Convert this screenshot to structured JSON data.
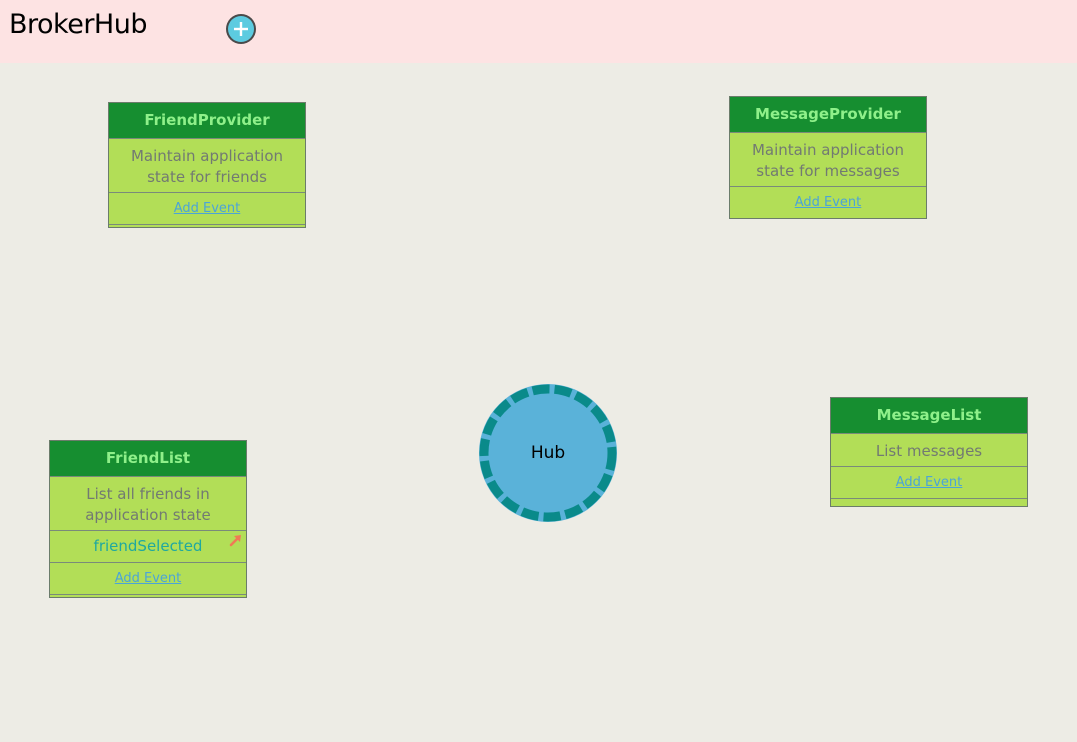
{
  "app": {
    "title": "BrokerHub",
    "add_icon": "plus-circle-icon"
  },
  "colors": {
    "header_bg": "#fde3e3",
    "workspace_bg": "#edece5",
    "card_header": "#168e30",
    "card_header_text": "#8ff08a",
    "card_body": "#b2de57",
    "hub_fill": "#5ab2d9",
    "hub_ring": "#0a8a8a",
    "link": "#4ba4d8",
    "event_text": "#1fa8a0",
    "event_arrow": "#f07a55"
  },
  "cards": {
    "friend_provider": {
      "title": "FriendProvider",
      "description": "Maintain application state for friends",
      "add_event": "Add Event"
    },
    "message_provider": {
      "title": "MessageProvider",
      "description": "Maintain application state for messages",
      "add_event": "Add Event"
    },
    "friend_list": {
      "title": "FriendList",
      "description": "List all friends in application state",
      "events": [
        "friendSelected"
      ],
      "event_icon": "arrow-up-right-icon",
      "add_event": "Add Event"
    },
    "message_list": {
      "title": "MessageList",
      "description": "List messages",
      "add_event": "Add Event"
    }
  },
  "hub": {
    "label": "Hub"
  }
}
